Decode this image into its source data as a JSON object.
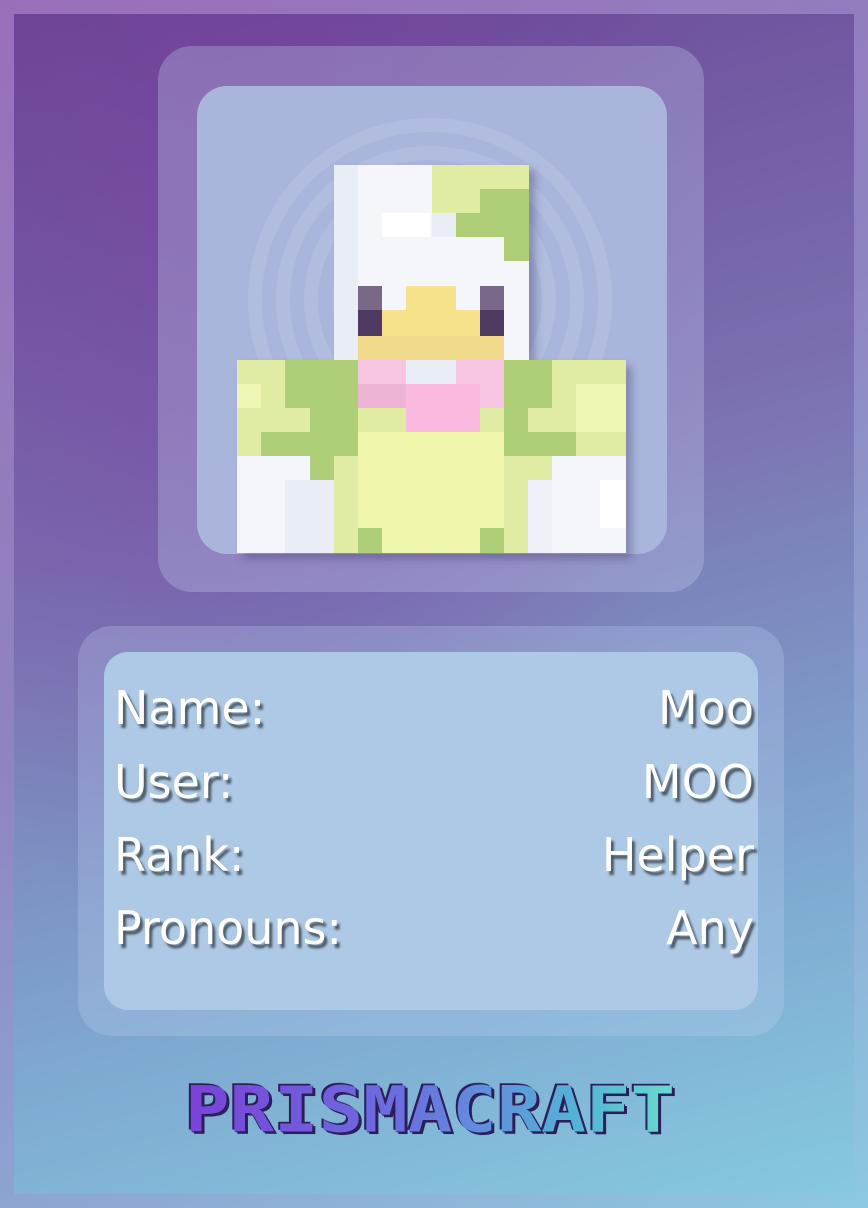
{
  "profile": {
    "rows": [
      {
        "label": "Name:",
        "value": "Moo"
      },
      {
        "label": "User:",
        "value": "MOO"
      },
      {
        "label": "Rank:",
        "value": "Helper"
      },
      {
        "label": "Pronouns:",
        "value": "Any"
      }
    ]
  },
  "brand": {
    "logo_text": "PRISMACRAFT"
  },
  "icons": {
    "avatar": "minecraft-duck-skin-icon"
  },
  "colors": {
    "panel": "#adc9e5",
    "skin_white": "#f4f6fb",
    "skin_green": "#aecf78",
    "skin_pale_green": "#e0eba4",
    "skin_yellow_belly": "#eff5aa",
    "skin_beak": "#f7e28c",
    "skin_bow_pink": "#f8c6e2",
    "skin_eye": "#4f3a62"
  }
}
